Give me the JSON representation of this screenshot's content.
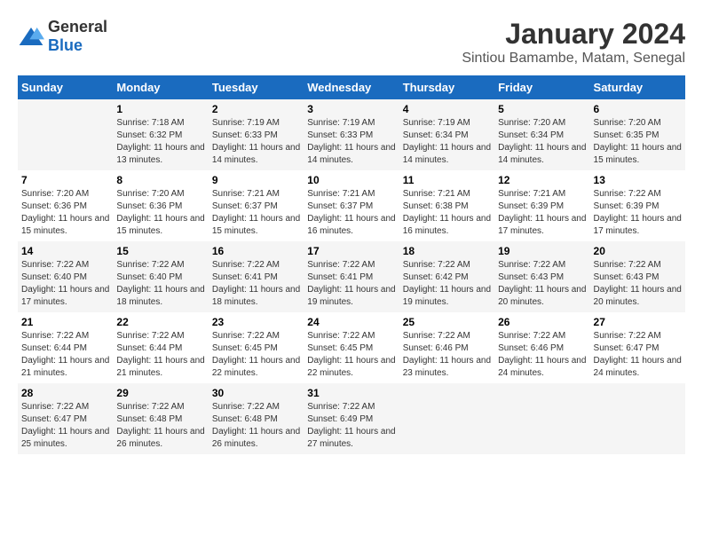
{
  "header": {
    "logo": {
      "general": "General",
      "blue": "Blue"
    },
    "title": "January 2024",
    "location": "Sintiou Bamambe, Matam, Senegal"
  },
  "days_of_week": [
    "Sunday",
    "Monday",
    "Tuesday",
    "Wednesday",
    "Thursday",
    "Friday",
    "Saturday"
  ],
  "weeks": [
    [
      {
        "day": "",
        "sunrise": "",
        "sunset": "",
        "daylight": ""
      },
      {
        "day": "1",
        "sunrise": "Sunrise: 7:18 AM",
        "sunset": "Sunset: 6:32 PM",
        "daylight": "Daylight: 11 hours and 13 minutes."
      },
      {
        "day": "2",
        "sunrise": "Sunrise: 7:19 AM",
        "sunset": "Sunset: 6:33 PM",
        "daylight": "Daylight: 11 hours and 14 minutes."
      },
      {
        "day": "3",
        "sunrise": "Sunrise: 7:19 AM",
        "sunset": "Sunset: 6:33 PM",
        "daylight": "Daylight: 11 hours and 14 minutes."
      },
      {
        "day": "4",
        "sunrise": "Sunrise: 7:19 AM",
        "sunset": "Sunset: 6:34 PM",
        "daylight": "Daylight: 11 hours and 14 minutes."
      },
      {
        "day": "5",
        "sunrise": "Sunrise: 7:20 AM",
        "sunset": "Sunset: 6:34 PM",
        "daylight": "Daylight: 11 hours and 14 minutes."
      },
      {
        "day": "6",
        "sunrise": "Sunrise: 7:20 AM",
        "sunset": "Sunset: 6:35 PM",
        "daylight": "Daylight: 11 hours and 15 minutes."
      }
    ],
    [
      {
        "day": "7",
        "sunrise": "Sunrise: 7:20 AM",
        "sunset": "Sunset: 6:36 PM",
        "daylight": "Daylight: 11 hours and 15 minutes."
      },
      {
        "day": "8",
        "sunrise": "Sunrise: 7:20 AM",
        "sunset": "Sunset: 6:36 PM",
        "daylight": "Daylight: 11 hours and 15 minutes."
      },
      {
        "day": "9",
        "sunrise": "Sunrise: 7:21 AM",
        "sunset": "Sunset: 6:37 PM",
        "daylight": "Daylight: 11 hours and 15 minutes."
      },
      {
        "day": "10",
        "sunrise": "Sunrise: 7:21 AM",
        "sunset": "Sunset: 6:37 PM",
        "daylight": "Daylight: 11 hours and 16 minutes."
      },
      {
        "day": "11",
        "sunrise": "Sunrise: 7:21 AM",
        "sunset": "Sunset: 6:38 PM",
        "daylight": "Daylight: 11 hours and 16 minutes."
      },
      {
        "day": "12",
        "sunrise": "Sunrise: 7:21 AM",
        "sunset": "Sunset: 6:39 PM",
        "daylight": "Daylight: 11 hours and 17 minutes."
      },
      {
        "day": "13",
        "sunrise": "Sunrise: 7:22 AM",
        "sunset": "Sunset: 6:39 PM",
        "daylight": "Daylight: 11 hours and 17 minutes."
      }
    ],
    [
      {
        "day": "14",
        "sunrise": "Sunrise: 7:22 AM",
        "sunset": "Sunset: 6:40 PM",
        "daylight": "Daylight: 11 hours and 17 minutes."
      },
      {
        "day": "15",
        "sunrise": "Sunrise: 7:22 AM",
        "sunset": "Sunset: 6:40 PM",
        "daylight": "Daylight: 11 hours and 18 minutes."
      },
      {
        "day": "16",
        "sunrise": "Sunrise: 7:22 AM",
        "sunset": "Sunset: 6:41 PM",
        "daylight": "Daylight: 11 hours and 18 minutes."
      },
      {
        "day": "17",
        "sunrise": "Sunrise: 7:22 AM",
        "sunset": "Sunset: 6:41 PM",
        "daylight": "Daylight: 11 hours and 19 minutes."
      },
      {
        "day": "18",
        "sunrise": "Sunrise: 7:22 AM",
        "sunset": "Sunset: 6:42 PM",
        "daylight": "Daylight: 11 hours and 19 minutes."
      },
      {
        "day": "19",
        "sunrise": "Sunrise: 7:22 AM",
        "sunset": "Sunset: 6:43 PM",
        "daylight": "Daylight: 11 hours and 20 minutes."
      },
      {
        "day": "20",
        "sunrise": "Sunrise: 7:22 AM",
        "sunset": "Sunset: 6:43 PM",
        "daylight": "Daylight: 11 hours and 20 minutes."
      }
    ],
    [
      {
        "day": "21",
        "sunrise": "Sunrise: 7:22 AM",
        "sunset": "Sunset: 6:44 PM",
        "daylight": "Daylight: 11 hours and 21 minutes."
      },
      {
        "day": "22",
        "sunrise": "Sunrise: 7:22 AM",
        "sunset": "Sunset: 6:44 PM",
        "daylight": "Daylight: 11 hours and 21 minutes."
      },
      {
        "day": "23",
        "sunrise": "Sunrise: 7:22 AM",
        "sunset": "Sunset: 6:45 PM",
        "daylight": "Daylight: 11 hours and 22 minutes."
      },
      {
        "day": "24",
        "sunrise": "Sunrise: 7:22 AM",
        "sunset": "Sunset: 6:45 PM",
        "daylight": "Daylight: 11 hours and 22 minutes."
      },
      {
        "day": "25",
        "sunrise": "Sunrise: 7:22 AM",
        "sunset": "Sunset: 6:46 PM",
        "daylight": "Daylight: 11 hours and 23 minutes."
      },
      {
        "day": "26",
        "sunrise": "Sunrise: 7:22 AM",
        "sunset": "Sunset: 6:46 PM",
        "daylight": "Daylight: 11 hours and 24 minutes."
      },
      {
        "day": "27",
        "sunrise": "Sunrise: 7:22 AM",
        "sunset": "Sunset: 6:47 PM",
        "daylight": "Daylight: 11 hours and 24 minutes."
      }
    ],
    [
      {
        "day": "28",
        "sunrise": "Sunrise: 7:22 AM",
        "sunset": "Sunset: 6:47 PM",
        "daylight": "Daylight: 11 hours and 25 minutes."
      },
      {
        "day": "29",
        "sunrise": "Sunrise: 7:22 AM",
        "sunset": "Sunset: 6:48 PM",
        "daylight": "Daylight: 11 hours and 26 minutes."
      },
      {
        "day": "30",
        "sunrise": "Sunrise: 7:22 AM",
        "sunset": "Sunset: 6:48 PM",
        "daylight": "Daylight: 11 hours and 26 minutes."
      },
      {
        "day": "31",
        "sunrise": "Sunrise: 7:22 AM",
        "sunset": "Sunset: 6:49 PM",
        "daylight": "Daylight: 11 hours and 27 minutes."
      },
      {
        "day": "",
        "sunrise": "",
        "sunset": "",
        "daylight": ""
      },
      {
        "day": "",
        "sunrise": "",
        "sunset": "",
        "daylight": ""
      },
      {
        "day": "",
        "sunrise": "",
        "sunset": "",
        "daylight": ""
      }
    ]
  ]
}
